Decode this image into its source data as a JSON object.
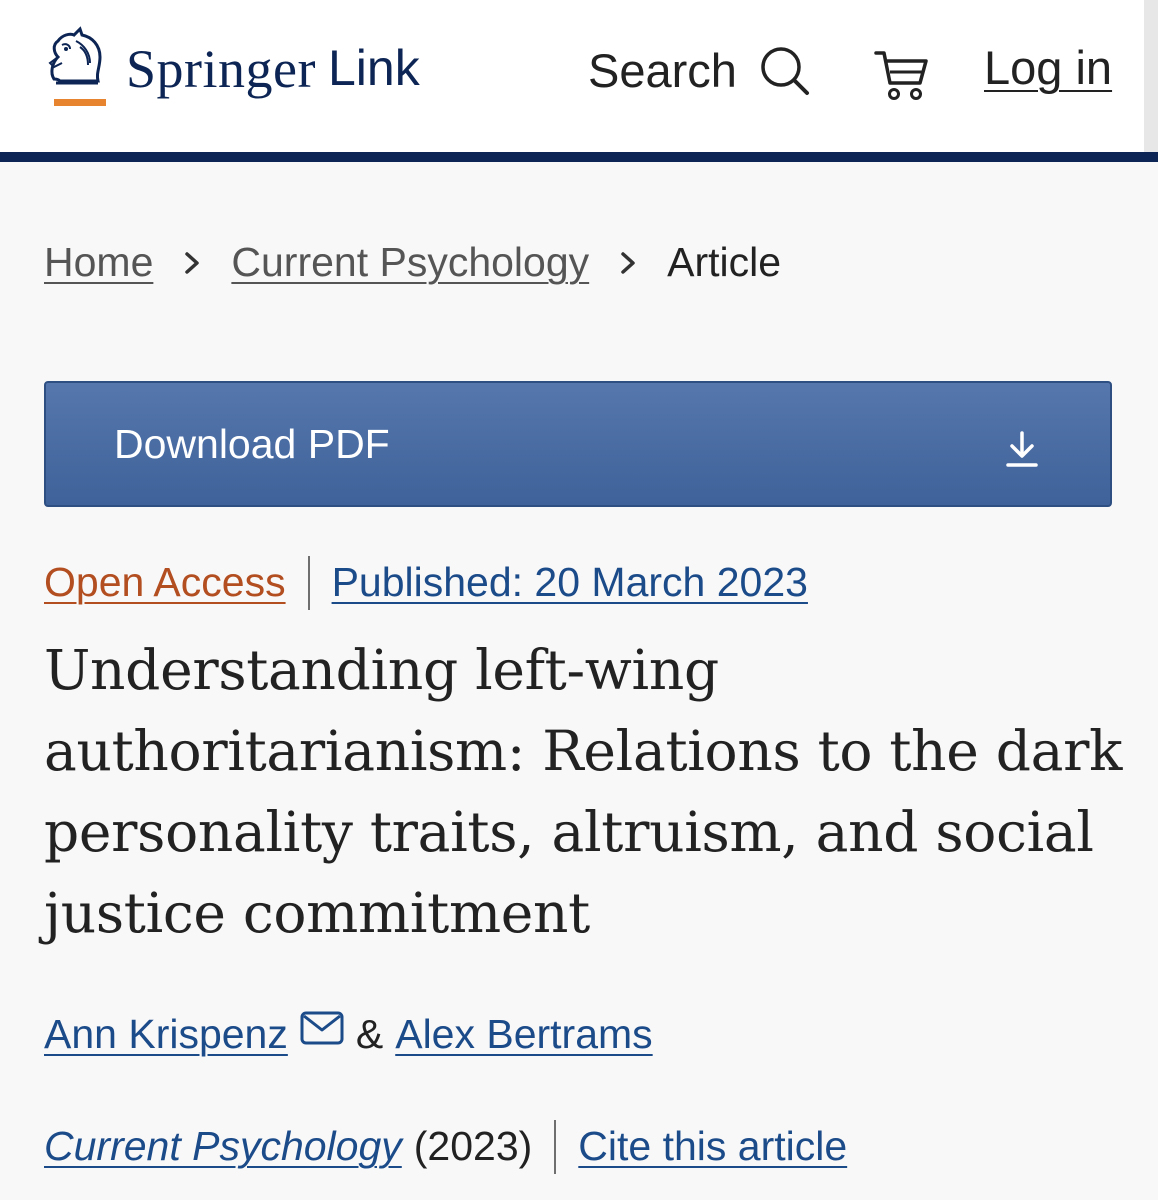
{
  "header": {
    "logo": {
      "brand": "Springer",
      "sub": "Link",
      "mark_icon": "knight-horse-icon"
    },
    "search_label": "Search",
    "search_icon": "search-icon",
    "cart_icon": "cart-icon",
    "login_label": "Log in"
  },
  "breadcrumb": {
    "items": [
      {
        "label": "Home"
      },
      {
        "label": "Current Psychology"
      }
    ],
    "current": "Article",
    "separator_icon": "chevron-right-icon"
  },
  "download": {
    "label": "Download PDF",
    "icon": "download-icon"
  },
  "meta": {
    "access": "Open Access",
    "published": "Published: 20 March 2023"
  },
  "article": {
    "title": "Understanding left-wing authoritarianism: Relations to the dark personality traits, altruism, and social justice commitment",
    "authors": [
      {
        "name": "Ann Krispenz",
        "icon": "mail-icon"
      },
      {
        "name": "Alex Bertrams"
      }
    ],
    "author_separator": "&",
    "journal": "Current Psychology",
    "year": "(2023)",
    "cite_label": "Cite this article"
  },
  "colors": {
    "brand_navy": "#0c2554",
    "logo_orange": "#e6842f",
    "link_blue": "#1c4b8a",
    "open_access_orange": "#b24e20",
    "download_button": "#4a6da4",
    "page_background": "#f8f8f8"
  }
}
